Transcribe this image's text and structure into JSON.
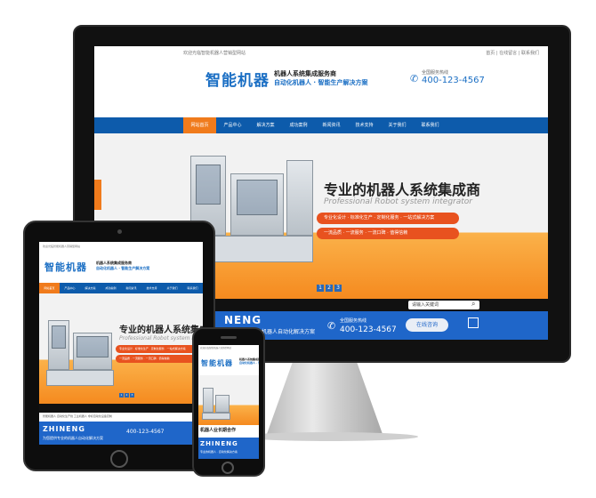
{
  "site": {
    "topbar_text": "欢迎光临智能机器人营销型网站",
    "topbar_links": "首页 | 在线留言 | 联系我们",
    "logo": "智能机器",
    "slogan_line1": "机器人系统集成服务商",
    "slogan_line2": "自动化机器人 · 智能生产解决方案",
    "hotline_label": "全国服务热线",
    "hotline": "400-123-4567",
    "nav": [
      "网站首页",
      "产品中心",
      "解决方案",
      "成功案例",
      "新闻资讯",
      "技术支持",
      "关于我们",
      "联系我们"
    ],
    "headline": "专业的机器人系统集成商",
    "subline": "Professional Robot system integrator",
    "pill1": "专业化设计 · 标准化生产 · 定制化服务 · 一站式解决方案",
    "pill2": "一流品质 · 一流服务 · 一流口碑 · 值得信赖",
    "dots": [
      "1",
      "2",
      "3"
    ],
    "search_placeholder": "请输入关键词",
    "brand_short": "NENG",
    "brand_full": "ZHINENG",
    "blue_sub": "为您提供专业的机器人自动化解决方案",
    "tel_label": "全国服务热线",
    "tel": "400-123-4567",
    "consult": "在线咨询",
    "row_text": "智能机器人  自动化生产线  工业机器人  非标自动化设备定制",
    "phone_bottom_text": "机器人业长期合作",
    "phone_caption": "专业的机器人 · 自动化解决方案"
  },
  "colors": {
    "primary_blue": "#0d5bab",
    "accent_orange": "#f07b1c",
    "cta_red": "#e8521f",
    "bar_blue": "#1f66c9"
  }
}
